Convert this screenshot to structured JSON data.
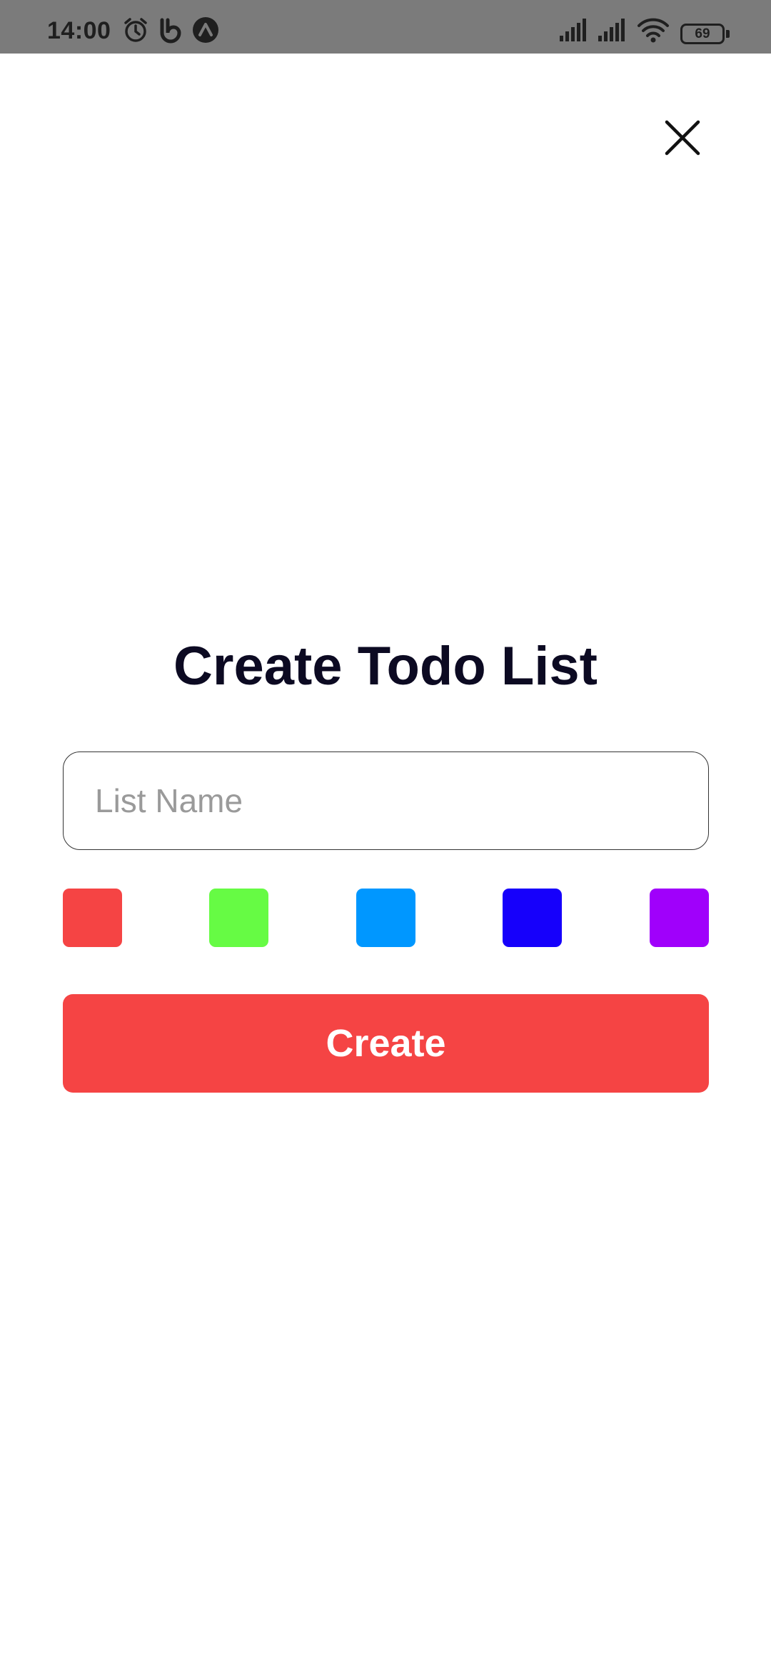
{
  "status_bar": {
    "time": "14:00",
    "battery_level": "69",
    "icons": [
      "alarm-icon",
      "vine-app-icon",
      "arrow-app-icon",
      "cellular-signal-icon",
      "cellular-signal-icon",
      "wifi-icon",
      "battery-icon"
    ]
  },
  "modal": {
    "close_icon": "close-icon",
    "title": "Create Todo List",
    "input": {
      "placeholder": "List Name",
      "value": ""
    },
    "colors": [
      {
        "name": "red",
        "hex": "#f54444"
      },
      {
        "name": "green",
        "hex": "#66fb44"
      },
      {
        "name": "blue",
        "hex": "#0097ff"
      },
      {
        "name": "dark-blue",
        "hex": "#1600fb"
      },
      {
        "name": "purple",
        "hex": "#a000fb"
      }
    ],
    "create_label": "Create",
    "accent_color": "#f54444"
  }
}
